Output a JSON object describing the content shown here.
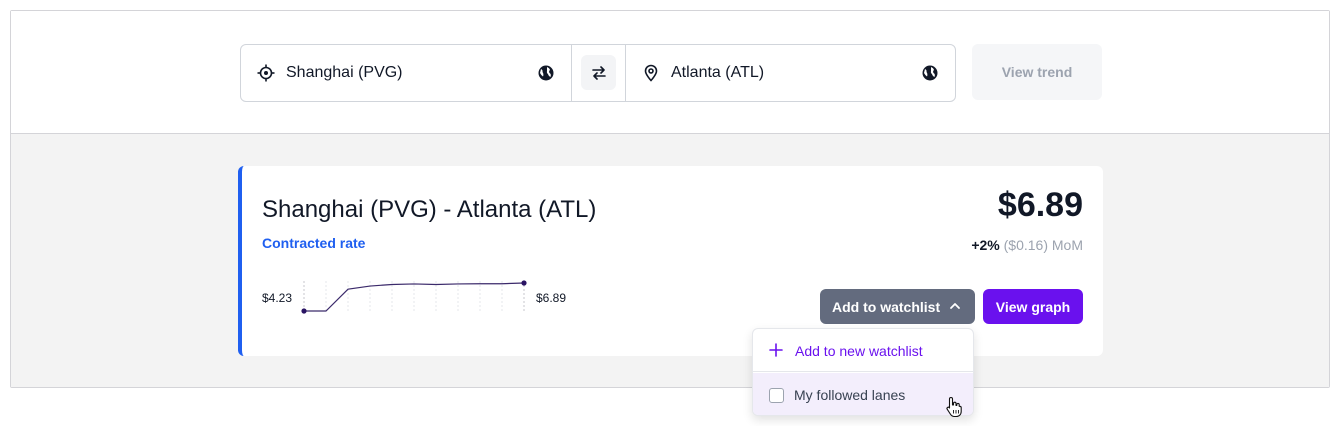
{
  "search": {
    "origin": {
      "value": "Shanghai (PVG)",
      "lead_icon": "crosshair-location-icon",
      "trail_icon": "globe-icon"
    },
    "swap_icon": "swap-arrows-icon",
    "destination": {
      "value": "Atlanta (ATL)",
      "lead_icon": "map-pin-icon",
      "trail_icon": "globe-icon"
    },
    "view_trend_label": "View trend"
  },
  "result_card": {
    "lane_title": "Shanghai (PVG) - Atlanta (ATL)",
    "rate_type": "Contracted rate",
    "price": "$6.89",
    "change_pct": "+2%",
    "change_detail": "($0.16) MoM",
    "sparkline": {
      "start_label": "$4.23",
      "end_label": "$6.89",
      "values": [
        4.23,
        4.23,
        6.3,
        6.6,
        6.75,
        6.8,
        6.75,
        6.8,
        6.82,
        6.82,
        6.89
      ]
    },
    "add_to_watchlist_label": "Add to watchlist",
    "view_graph_label": "View graph"
  },
  "watchlist_dropdown": {
    "add_new_label": "Add to new watchlist",
    "items": [
      {
        "label": "My followed lanes",
        "checked": false
      }
    ]
  },
  "colors": {
    "accent_blue": "#1f5ff0",
    "primary_purple": "#6a11ee",
    "watchlist_button": "#636b7e"
  }
}
